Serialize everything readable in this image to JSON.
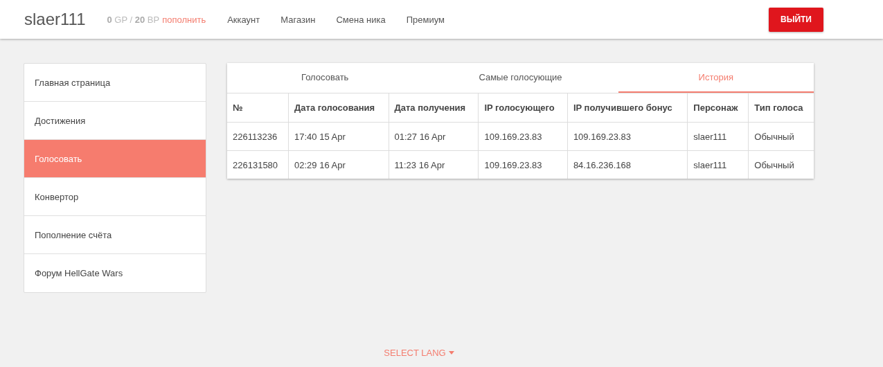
{
  "header": {
    "username": "slaer111",
    "balance": "**0** GP / **20** BP",
    "topup_link": "пополнить",
    "nav": [
      "Аккаунт",
      "Магазин",
      "Смена ника",
      "Премиум"
    ],
    "logout_button": "ВЫЙТИ"
  },
  "sidebar": {
    "items": [
      {
        "label": "Главная страница",
        "selected": false
      },
      {
        "label": "Достижения",
        "selected": false
      },
      {
        "label": "Голосовать",
        "selected": true
      },
      {
        "label": "Конвертор",
        "selected": false
      },
      {
        "label": "Пополнение счёта",
        "selected": false
      },
      {
        "label": "Форум HellGate Wars",
        "selected": false
      }
    ]
  },
  "tabs": [
    {
      "label": "Голосовать",
      "selected": false
    },
    {
      "label": "Самые голосующие",
      "selected": false
    },
    {
      "label": "История",
      "selected": true
    }
  ],
  "table": {
    "columns": [
      "№",
      "Дата голосования",
      "Дата получения",
      "IP голосующего",
      "IP получившего бонус",
      "Персонаж",
      "Тип голоса"
    ],
    "rows": [
      [
        "226113236",
        "17:40 15 Apr",
        "01:27 16 Apr",
        "109.169.23.83",
        "109.169.23.83",
        "slaer111",
        "Обычный"
      ],
      [
        "226131580",
        "02:29 16 Apr",
        "11:23 16 Apr",
        "109.169.23.83",
        "84.16.236.168",
        "slaer111",
        "Обычный"
      ]
    ]
  },
  "footer": {
    "lang_button": "SELECT LANG"
  }
}
